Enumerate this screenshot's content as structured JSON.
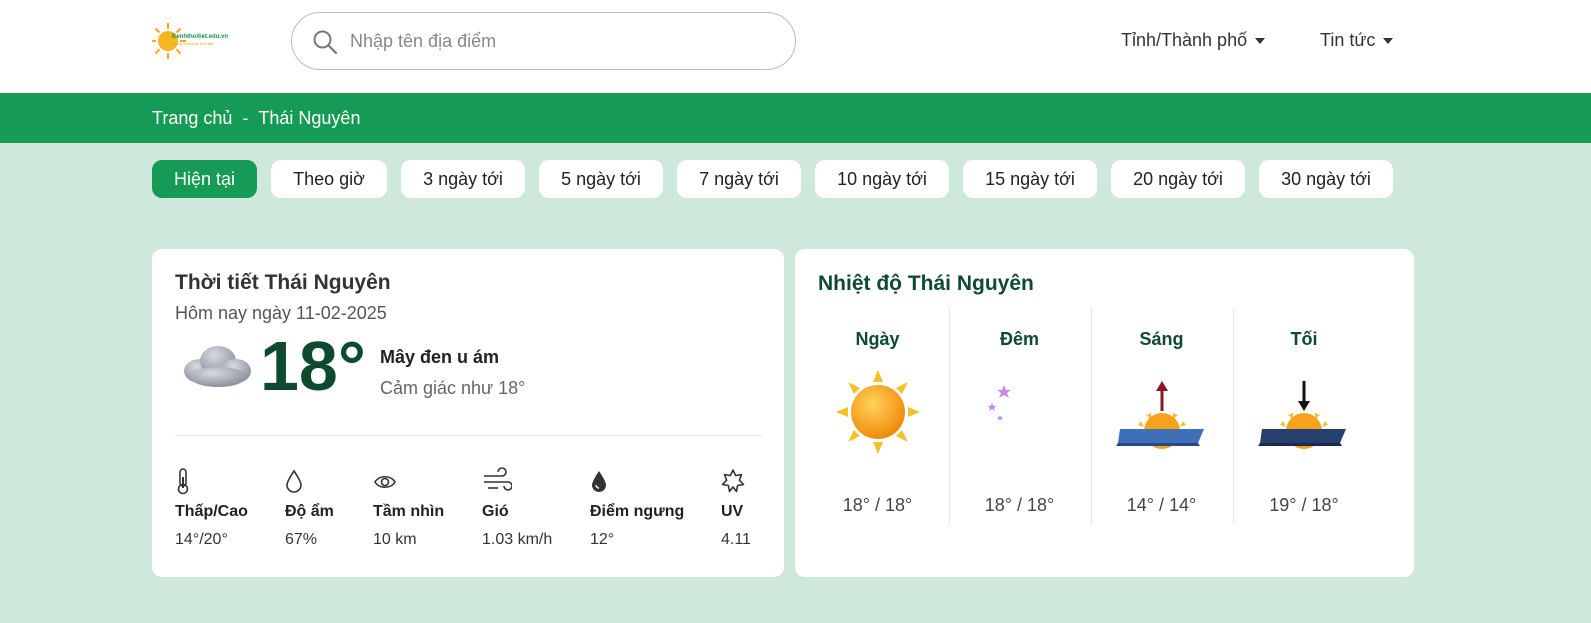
{
  "header": {
    "logo_text": "Kenhthoitiet.edu.vn",
    "logo_tagline": "Trang thông tin thời tiết",
    "search_placeholder": "Nhập tên địa điểm",
    "nav": [
      "Tỉnh/Thành phố",
      "Tin tức"
    ]
  },
  "breadcrumb": {
    "home": "Trang chủ",
    "separator": "-",
    "current": "Thái Nguyên"
  },
  "tabs": [
    {
      "label": "Hiện tại",
      "active": true
    },
    {
      "label": "Theo giờ",
      "active": false
    },
    {
      "label": "3 ngày tới",
      "active": false
    },
    {
      "label": "5 ngày tới",
      "active": false
    },
    {
      "label": "7 ngày tới",
      "active": false
    },
    {
      "label": "10 ngày tới",
      "active": false
    },
    {
      "label": "15 ngày tới",
      "active": false
    },
    {
      "label": "20 ngày tới",
      "active": false
    },
    {
      "label": "30 ngày tới",
      "active": false
    }
  ],
  "current": {
    "title": "Thời tiết Thái Nguyên",
    "date": "Hôm nay ngày 11-02-2025",
    "icon": "cloud-icon",
    "temperature": "18°",
    "condition": "Mây đen u ám",
    "feels_like": "Cảm giác như 18°",
    "stats": [
      {
        "icon": "thermometer-icon",
        "label": "Thấp/Cao",
        "value": "14°/20°"
      },
      {
        "icon": "droplet-icon",
        "label": "Độ ẩm",
        "value": "67%"
      },
      {
        "icon": "eye-icon",
        "label": "Tầm nhìn",
        "value": "10 km"
      },
      {
        "icon": "wind-icon",
        "label": "Gió",
        "value": "1.03 km/h"
      },
      {
        "icon": "dewpoint-icon",
        "label": "Điểm ngưng",
        "value": "12°"
      },
      {
        "icon": "uv-sun-icon",
        "label": "UV",
        "value": "4.11"
      }
    ]
  },
  "temperatures": {
    "title": "Nhiệt độ Thái Nguyên",
    "periods": [
      {
        "name": "Ngày",
        "icon": "sun-icon",
        "temp": "18° / 18°"
      },
      {
        "name": "Đêm",
        "icon": "moon-icon",
        "temp": "18° / 18°"
      },
      {
        "name": "Sáng",
        "icon": "sunrise-icon",
        "temp": "14° / 14°"
      },
      {
        "name": "Tối",
        "icon": "sunset-icon",
        "temp": "19° / 18°"
      }
    ]
  },
  "colors": {
    "brand_green": "#159b55",
    "background": "#cfe8dc",
    "dark_green_text": "#0e4a2f"
  }
}
